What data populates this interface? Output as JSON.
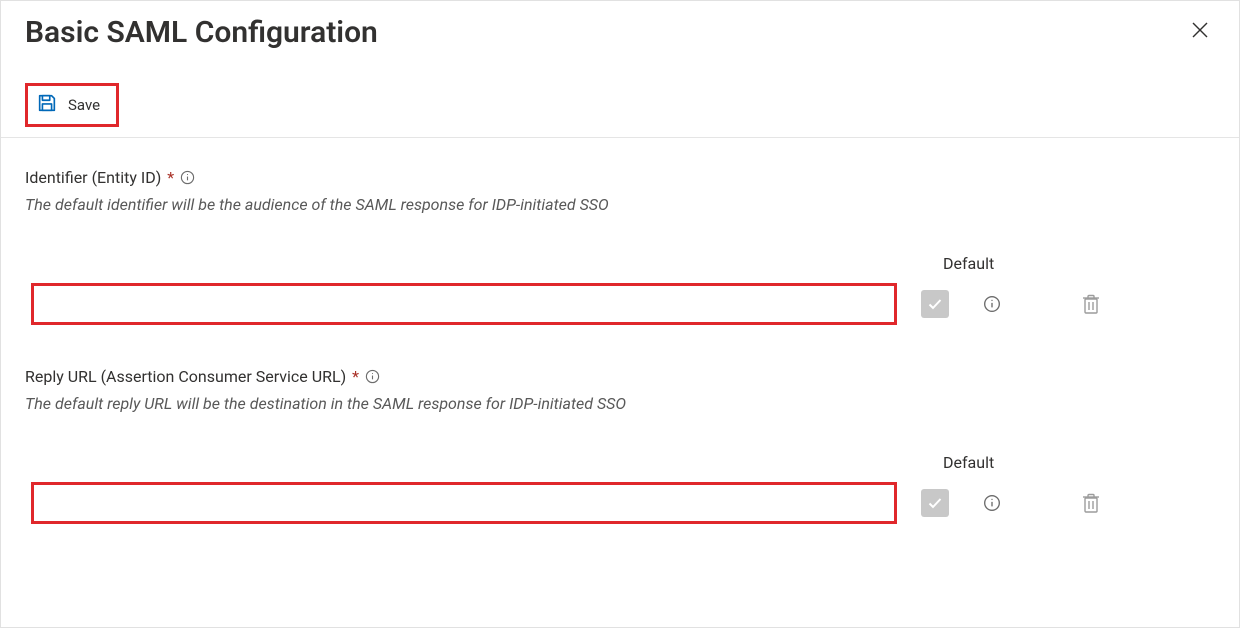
{
  "header": {
    "title": "Basic SAML Configuration"
  },
  "toolbar": {
    "save_label": "Save"
  },
  "sections": {
    "identifier": {
      "label": "Identifier (Entity ID)",
      "required_mark": "*",
      "description": "The default identifier will be the audience of the SAML response for IDP-initiated SSO",
      "default_header": "Default",
      "value": ""
    },
    "reply_url": {
      "label": "Reply URL (Assertion Consumer Service URL)",
      "required_mark": "*",
      "description": "The default reply URL will be the destination in the SAML response for IDP-initiated SSO",
      "default_header": "Default",
      "value": ""
    }
  }
}
